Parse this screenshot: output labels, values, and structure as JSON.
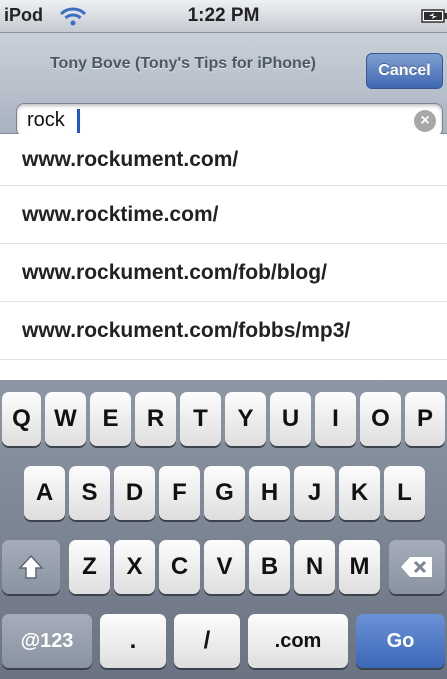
{
  "status_bar": {
    "carrier": "iPod",
    "time": "1:22 PM",
    "wifi_icon": "wifi-icon",
    "battery_icon": "battery-charging-icon"
  },
  "nav": {
    "title": "Tony Bove (Tony's Tips for iPhone)",
    "cancel_label": "Cancel"
  },
  "url_field": {
    "value": "rock",
    "clear_icon": "clear-icon"
  },
  "suggestions": [
    "www.rockument.com/",
    "www.rocktime.com/",
    "www.rockument.com/fob/blog/",
    "www.rockument.com/fobbs/mp3/"
  ],
  "keyboard": {
    "row1": [
      "Q",
      "W",
      "E",
      "R",
      "T",
      "Y",
      "U",
      "I",
      "O",
      "P"
    ],
    "row2": [
      "A",
      "S",
      "D",
      "F",
      "G",
      "H",
      "J",
      "K",
      "L"
    ],
    "row3": [
      "Z",
      "X",
      "C",
      "V",
      "B",
      "N",
      "M"
    ],
    "bottom": {
      "numbers": "@123",
      "dot": ".",
      "slash": "/",
      "dotcom": ".com",
      "go": "Go"
    },
    "shift_icon": "shift-arrow-icon",
    "backspace_icon": "backspace-icon"
  },
  "colors": {
    "accent": "#4068b3",
    "keyboard_bg": "#7c8593",
    "caret": "#1a57d4"
  }
}
